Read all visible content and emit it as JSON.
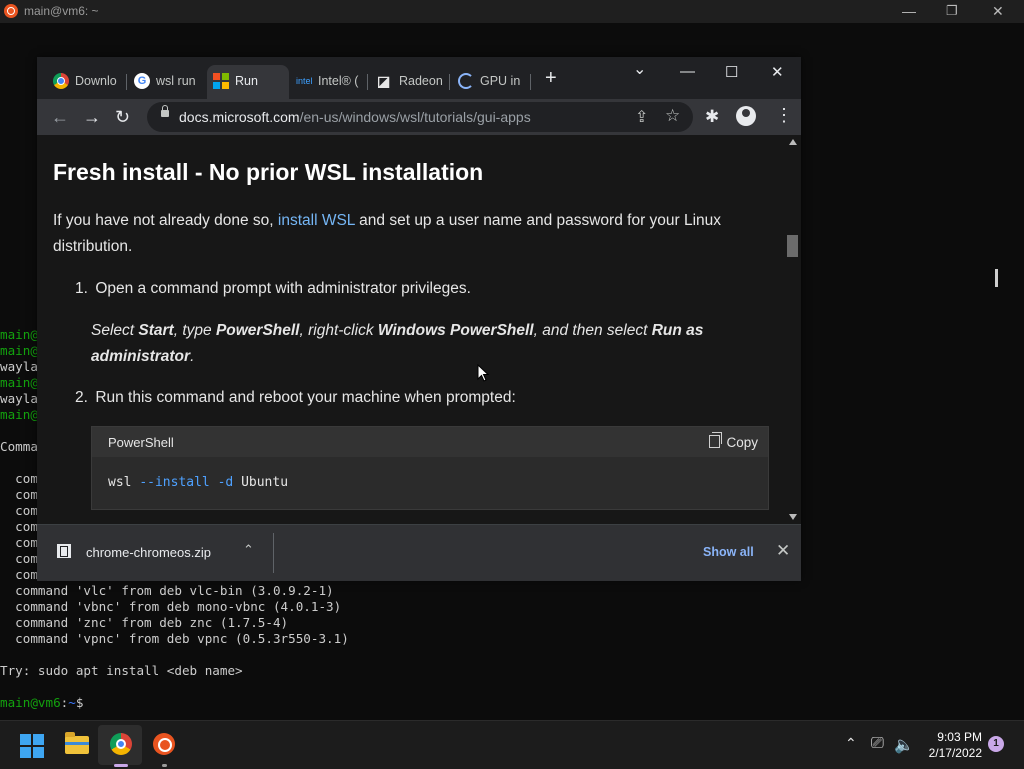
{
  "terminal": {
    "title": "main@vm6: ~",
    "controls": {
      "minimize": "—",
      "maximize": "❐",
      "close": "✕"
    },
    "partial_lines": [
      {
        "user": "main@",
        "rest": ""
      },
      {
        "user": "main@",
        "rest": ""
      },
      {
        "user": "",
        "rest": "wayla"
      },
      {
        "user": "main@",
        "rest": ""
      },
      {
        "user": "",
        "rest": "wayla"
      },
      {
        "user": "main@",
        "rest": ""
      }
    ],
    "command_prefix_line": "Comma",
    "partial_com_lines": [
      "  com",
      "  com",
      "  com",
      "  com",
      "  com",
      "  com",
      "  com"
    ],
    "lines": [
      "  command 'vlc' from deb vlc-bin (3.0.9.2-1)",
      "  command 'vbnc' from deb mono-vbnc (4.0.1-3)",
      "  command 'znc' from deb znc (1.7.5-4)",
      "  command 'vpnc' from deb vpnc (0.5.3r550-3.1)",
      "",
      "Try: sudo apt install <deb name>"
    ],
    "prompt": {
      "user": "main@vm6",
      "sep": ":",
      "path": "~",
      "symbol": "$"
    }
  },
  "browser": {
    "tabs": [
      {
        "label": "Downlo",
        "icon": "chrome-icon"
      },
      {
        "label": "wsl run",
        "icon": "google-icon"
      },
      {
        "label": "Run",
        "icon": "microsoft-icon",
        "active": true
      },
      {
        "label": "Intel® (",
        "icon": "intel-icon"
      },
      {
        "label": "Radeon",
        "icon": "amd-icon"
      },
      {
        "label": "GPU in",
        "icon": "loading-spinner-icon"
      }
    ],
    "new_tab": "+",
    "tab_search": "⌄",
    "window_controls": {
      "minimize": "—",
      "maximize": "☐",
      "close": "✕"
    },
    "nav": {
      "back": "←",
      "forward": "→",
      "reload": "↻"
    },
    "url": {
      "host": "docs.microsoft.com",
      "path": "/en-us/windows/wsl/tutorials/gui-apps"
    },
    "toolbar_icons": {
      "share": "⇪",
      "bookmark": "☆",
      "extensions": "✱",
      "menu": "⋮"
    }
  },
  "page": {
    "heading": "Fresh install - No prior WSL installation",
    "intro_before": "If you have not already done so, ",
    "intro_link": "install WSL",
    "intro_after": " and set up a user name and password for your Linux distribution.",
    "step1": {
      "num": "1.",
      "text": "Open a command prompt with administrator privileges."
    },
    "note": {
      "p1": "Select ",
      "b1": "Start",
      "p2": ", type ",
      "b2": "PowerShell",
      "p3": ", right-click ",
      "b3": "Windows PowerShell",
      "p4": ", and then select ",
      "b4": "Run as administrator",
      "p5": "."
    },
    "step2": {
      "num": "2.",
      "text": "Run this command and reboot your machine when prompted:"
    },
    "code": {
      "language": "PowerShell",
      "copy_label": "Copy",
      "cmd_base": "wsl ",
      "cmd_opt1": "--install",
      "cmd_opt2": "-d",
      "cmd_arg": " Ubuntu"
    }
  },
  "download_bar": {
    "file": "chrome-chromeos.zip",
    "chevron": "⌃",
    "show_all": "Show all",
    "close": "✕"
  },
  "taskbar": {
    "tray": {
      "chevron": "⌃",
      "network": "⎚",
      "volume": "🔈"
    },
    "time": "9:03 PM",
    "date": "2/17/2022",
    "notifications": "1"
  },
  "colors": {
    "terminal_green": "#13a10e",
    "terminal_blue": "#3b78ff",
    "link_blue": "#75b6f5",
    "chrome_dark": "#202124",
    "toolbar": "#35363a"
  }
}
